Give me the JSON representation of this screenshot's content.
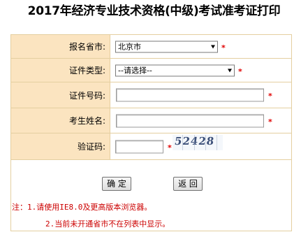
{
  "title": "2017年经济专业技术资格(中级)考试准考证打印",
  "form": {
    "province": {
      "label": "报名省市:",
      "value": "北京市"
    },
    "id_type": {
      "label": "证件类型:",
      "value": "--请选择--"
    },
    "id_number": {
      "label": "证件号码:",
      "value": ""
    },
    "name": {
      "label": "考生姓名:",
      "value": ""
    },
    "captcha": {
      "label": "验证码:",
      "value": "",
      "image_text": "52428"
    },
    "required_mark": "*"
  },
  "buttons": {
    "confirm": "确 定",
    "back": "返 回"
  },
  "notes": {
    "line1": "注：1.请使用IE8.0及更高版本浏览器。",
    "line2": "2.当前未开通省市不在列表中显示。"
  },
  "colors": {
    "label_bg": "#fbe4c0",
    "border": "#e4cfa0",
    "required": "#e00000",
    "note_text": "#cc0000"
  }
}
